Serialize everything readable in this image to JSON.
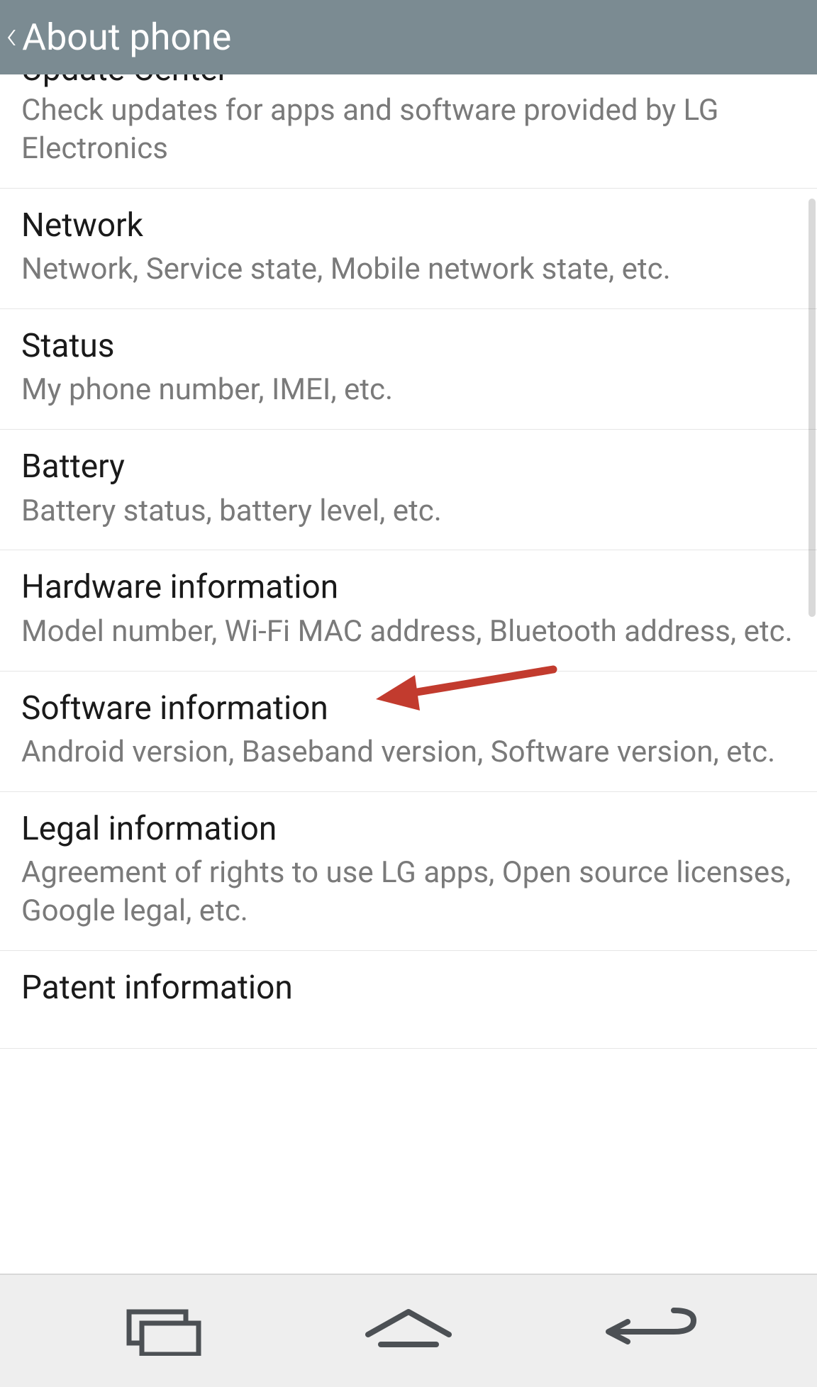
{
  "header": {
    "title": "About phone"
  },
  "items": [
    {
      "title": "Update Center",
      "subtitle": "Check updates for apps and software provided by LG Electronics"
    },
    {
      "title": "Network",
      "subtitle": "Network, Service state, Mobile network state, etc."
    },
    {
      "title": "Status",
      "subtitle": "My phone number, IMEI, etc."
    },
    {
      "title": "Battery",
      "subtitle": "Battery status, battery level, etc."
    },
    {
      "title": "Hardware information",
      "subtitle": "Model number, Wi-Fi MAC address, Bluetooth address, etc."
    },
    {
      "title": "Software information",
      "subtitle": "Android version, Baseband version, Software version, etc."
    },
    {
      "title": "Legal information",
      "subtitle": "Agreement of rights to use LG apps, Open source licenses, Google legal, etc."
    },
    {
      "title": "Patent information",
      "subtitle": ""
    }
  ],
  "annotation": {
    "arrow_color": "#c23b2e"
  }
}
